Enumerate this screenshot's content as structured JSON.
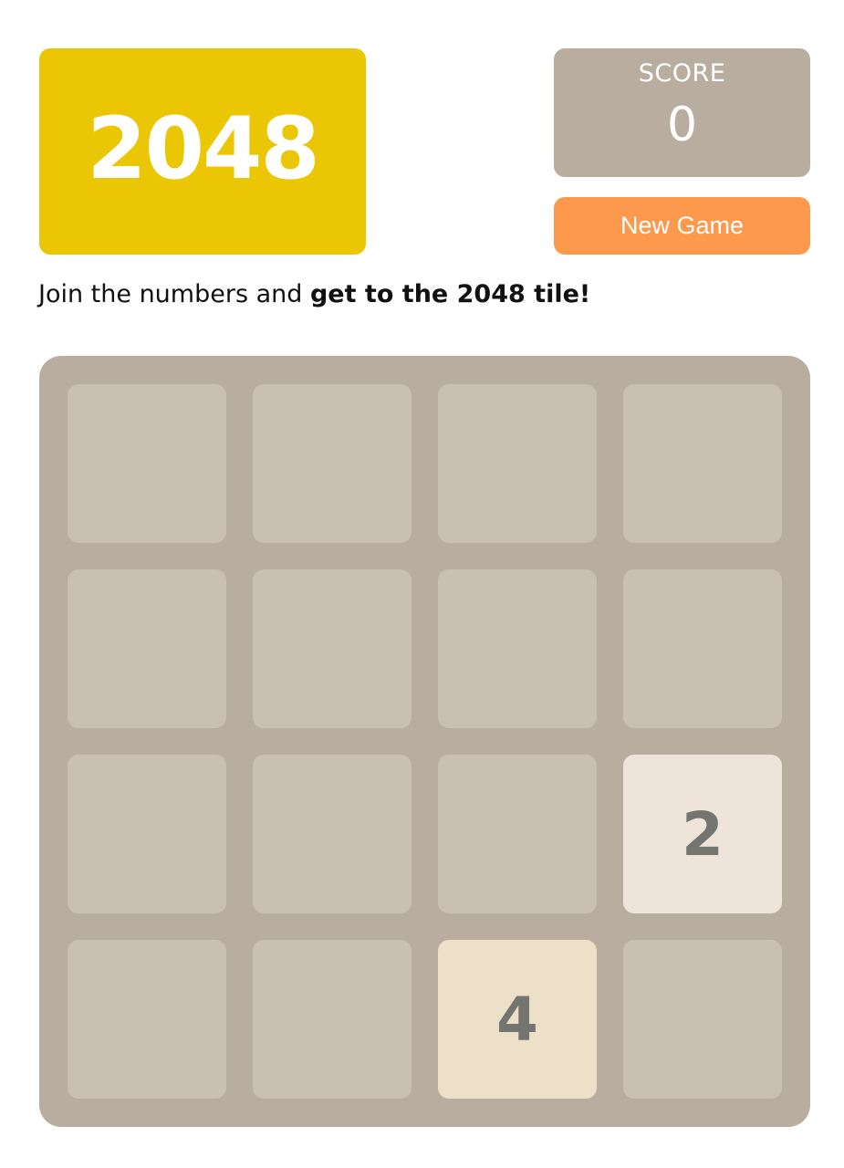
{
  "header": {
    "title": "2048",
    "score_label": "SCORE",
    "score_value": "0",
    "new_game_label": "New Game"
  },
  "intro": {
    "text_plain": "Join the numbers and ",
    "text_bold": "get to the 2048 tile!"
  },
  "board": {
    "size": 4,
    "cells": [
      [
        "",
        "",
        "",
        ""
      ],
      [
        "",
        "",
        "",
        ""
      ],
      [
        "",
        "",
        "",
        "2"
      ],
      [
        "",
        "",
        "4",
        ""
      ]
    ]
  },
  "colors": {
    "title_bg": "#ebc604",
    "score_bg": "#b9ad9f",
    "new_game_bg": "#fd994c",
    "board_bg": "#b9ad9f",
    "empty_cell": "#cac0b1",
    "tile_2": "#eee4da",
    "tile_4": "#ede0c8",
    "tile_text": "#747470"
  }
}
